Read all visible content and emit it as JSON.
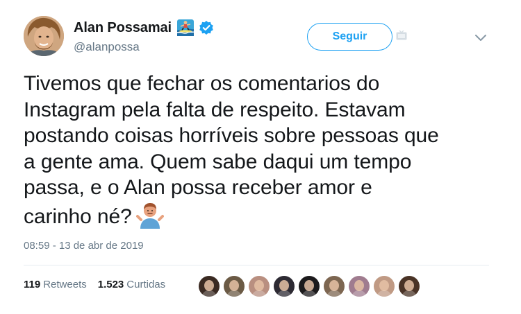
{
  "header": {
    "display_name": "Alan Possamai",
    "handle": "@alanpossa",
    "follow_label": "Seguir",
    "name_emoji": "surfer-emoji",
    "verified_badge": "verified-badge-icon",
    "accent_color": "#1da1f2"
  },
  "tweet": {
    "lines": [
      "Tivemos que fechar os comentarios do",
      "Instagram pela falta de respeito. Estavam",
      "postando coisas horríveis sobre pessoas que",
      "a gente ama. Quem sabe daqui um tempo",
      "passa, e o Alan possa receber amor e",
      "carinho né?"
    ],
    "trailing_emoji": "man-shrugging-emoji",
    "timestamp": "08:59 - 13 de abr de 2019"
  },
  "stats": {
    "retweets_count": "119",
    "retweets_label": "Retweets",
    "likes_count": "1.523",
    "likes_label": "Curtidas",
    "liker_avatars": [
      {
        "name": "liker-avatar-1",
        "color": "#3a2a22"
      },
      {
        "name": "liker-avatar-2",
        "color": "#6b5a45"
      },
      {
        "name": "liker-avatar-3",
        "color": "#b98f80"
      },
      {
        "name": "liker-avatar-4",
        "color": "#2d2a33"
      },
      {
        "name": "liker-avatar-5",
        "color": "#1c1a1c"
      },
      {
        "name": "liker-avatar-6",
        "color": "#7d6651"
      },
      {
        "name": "liker-avatar-7",
        "color": "#a07c8f"
      },
      {
        "name": "liker-avatar-8",
        "color": "#c09a84"
      },
      {
        "name": "liker-avatar-9",
        "color": "#4a3326"
      }
    ]
  }
}
